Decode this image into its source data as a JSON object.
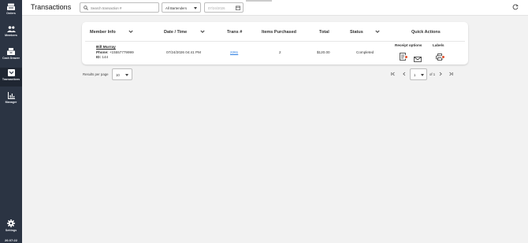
{
  "sidebar": {
    "items": [
      {
        "label": "Orders",
        "icon": "register-icon"
      },
      {
        "label": "Members",
        "icon": "members-icon"
      },
      {
        "label": "Cash Drawer",
        "icon": "cash-drawer-icon"
      },
      {
        "label": "Transactions",
        "icon": "transactions-icon"
      },
      {
        "label": "Manager",
        "icon": "manager-chart-icon"
      },
      {
        "label": "Settings",
        "icon": "gear-icon"
      }
    ],
    "active": "Transactions",
    "clock": "26:07:22"
  },
  "header": {
    "title": "Transactions",
    "search_placeholder": "Search transaction #",
    "bartender_select": "All Bartenders",
    "date_value": "07/24/2026"
  },
  "table": {
    "columns": [
      "Member Info",
      "Date / Time",
      "Trans #",
      "Items Purchased",
      "Total",
      "Status",
      "Quick Actions"
    ],
    "rows": [
      {
        "member_name": "Bill Murray",
        "phone_label": "Phone:",
        "phone": "+15557779999",
        "id_label": "ID:",
        "id": "144",
        "datetime": "07/24/2026 04:41 PM",
        "trans_no": "2261",
        "items": "2",
        "total": "$120.00",
        "status": "Completed"
      }
    ],
    "quick_actions": {
      "receipt_label": "Receipt options",
      "labels_label": "Labels"
    }
  },
  "pagination": {
    "rows_per_page_label": "Results per page",
    "rows_per_page": "10",
    "page": "1",
    "of_label": "of 1"
  },
  "colors": {
    "sidebar": "#2b3443",
    "link": "#2a7de1",
    "badge": "#e2502b"
  }
}
